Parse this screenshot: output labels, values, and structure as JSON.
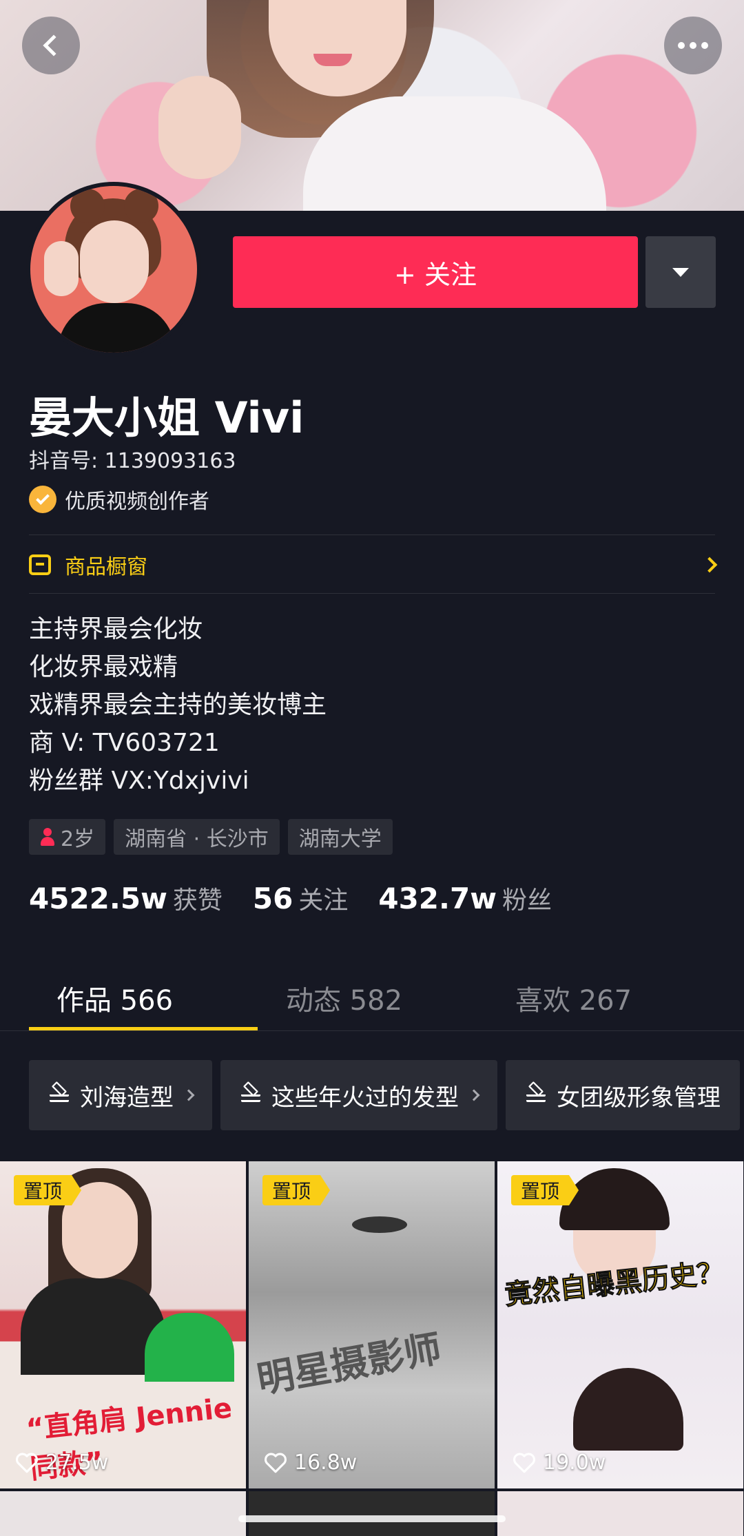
{
  "header": {
    "back_icon": "chevron-left-icon",
    "more_icon": "more-horizontal-icon"
  },
  "profile": {
    "follow_label": "+ 关注",
    "name": "晏大小姐 Vivi",
    "douyin_id": "抖音号: 1139093163",
    "verified_label": "优质视频创作者",
    "shop_label": "商品橱窗",
    "bio": [
      "主持界最会化妆",
      "化妆界最戏精",
      "戏精界最会主持的美妆博主",
      "商 V: TV603721",
      "粉丝群 VX:Ydxjvivi"
    ],
    "tags": {
      "age": "2岁",
      "location": "湖南省 · 长沙市",
      "school": "湖南大学"
    },
    "stats": [
      {
        "num": "4522.5w",
        "label": "获赞"
      },
      {
        "num": "56",
        "label": "关注"
      },
      {
        "num": "432.7w",
        "label": "粉丝"
      }
    ]
  },
  "tabs": [
    {
      "label": "作品 566",
      "active": true
    },
    {
      "label": "动态 582",
      "active": false
    },
    {
      "label": "喜欢 267",
      "active": false
    }
  ],
  "collections": [
    "刘海造型",
    "这些年火过的发型",
    "女团级形象管理"
  ],
  "videos": [
    {
      "pin": "置顶",
      "likes": "27.5w",
      "overlay": "“直角肩 Jennie同款”"
    },
    {
      "pin": "置顶",
      "likes": "16.8w",
      "overlay": "明星摄影师"
    },
    {
      "pin": "置顶",
      "likes": "19.0w",
      "overlay": "竟然自曝黑历史？"
    }
  ],
  "colors": {
    "accent": "#fe2c55",
    "highlight": "#face15",
    "background": "#161823"
  }
}
